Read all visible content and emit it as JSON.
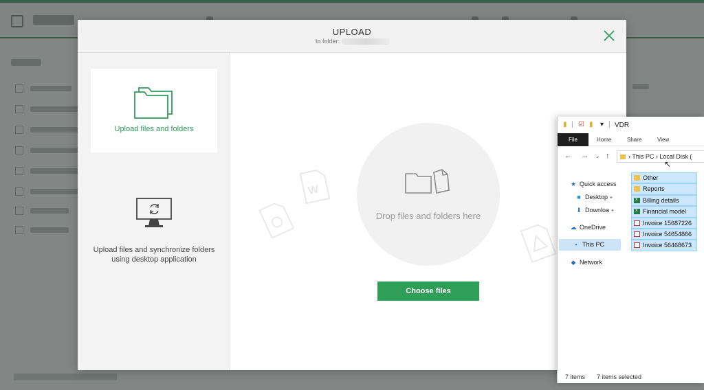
{
  "modal": {
    "title": "UPLOAD",
    "subtitle": "to folder:",
    "close_icon": "close-icon",
    "options": [
      {
        "label": "Upload files and folders",
        "icon": "folders-icon",
        "active": true
      },
      {
        "label": "Upload files and synchronize folders using desktop application",
        "icon": "monitor-sync-icon",
        "active": false
      }
    ],
    "drop_text": "Drop files and folders here",
    "choose_button": "Choose files",
    "accent_color": "#2f9e57"
  },
  "explorer": {
    "window_title": "VDR",
    "ribbon_tabs": [
      "File",
      "Home",
      "Share",
      "View"
    ],
    "address": {
      "segments": [
        "This PC",
        "Local Disk ("
      ]
    },
    "nav_pane": [
      {
        "label": "Quick access",
        "icon": "star-icon"
      },
      {
        "label": "Desktop",
        "icon": "desktop-icon",
        "pinned": true
      },
      {
        "label": "Downloa",
        "icon": "download-icon",
        "pinned": true
      },
      {
        "label": "OneDrive",
        "icon": "cloud-icon"
      },
      {
        "label": "This PC",
        "icon": "pc-icon",
        "selected": true
      },
      {
        "label": "Network",
        "icon": "network-icon"
      }
    ],
    "files": [
      {
        "name": "Other",
        "type": "folder"
      },
      {
        "name": "Reports",
        "type": "folder"
      },
      {
        "name": "Billing details",
        "type": "excel"
      },
      {
        "name": "Financial model",
        "type": "excel"
      },
      {
        "name": "Invoice 15687226",
        "type": "pdf"
      },
      {
        "name": "Invoice 54654866",
        "type": "pdf"
      },
      {
        "name": "Invoice 56468673",
        "type": "pdf"
      }
    ],
    "status": {
      "items": "7 items",
      "selected": "7 items selected"
    }
  }
}
